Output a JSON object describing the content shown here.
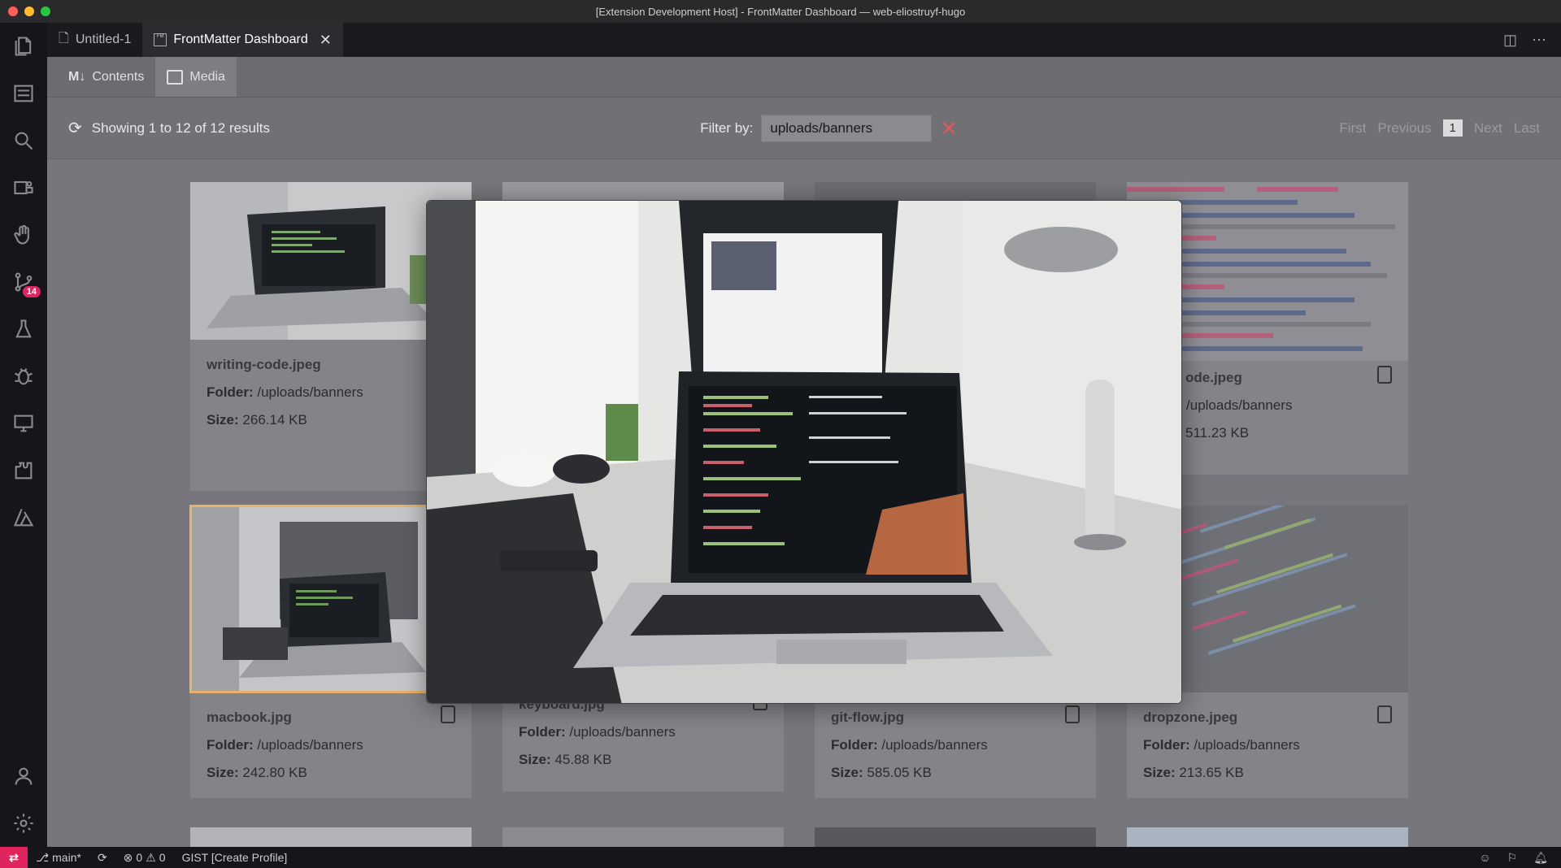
{
  "window": {
    "title": "[Extension Development Host] - FrontMatter Dashboard — web-eliostruyf-hugo"
  },
  "tabs": [
    {
      "label": "Untitled-1"
    },
    {
      "label": "FrontMatter Dashboard"
    }
  ],
  "activity": {
    "badge": "14"
  },
  "subnav": {
    "contents": "Contents",
    "media": "Media",
    "md_mark": "M↓"
  },
  "toolbar": {
    "results": "Showing 1 to 12 of 12 results",
    "filter_label": "Filter by:",
    "filter_value": "uploads/banners",
    "clear": "✕",
    "pager": {
      "first": "First",
      "previous": "Previous",
      "current": "1",
      "next": "Next",
      "last": "Last"
    }
  },
  "cards": [
    {
      "name": "writing-code.jpeg",
      "folder_label": "Folder:",
      "folder": "/uploads/banners",
      "size_label": "Size:",
      "size": "266.14 KB"
    },
    {
      "name": "ode.jpeg",
      "folder_label": "r:",
      "folder": "/uploads/banners",
      "size_label": "",
      "size": "511.23 KB"
    },
    {
      "name": "macbook.jpg",
      "folder_label": "Folder:",
      "folder": "/uploads/banners",
      "size_label": "Size:",
      "size": "242.80 KB"
    },
    {
      "name": "keyboard.jpg",
      "folder_label": "Folder:",
      "folder": "/uploads/banners",
      "size_label": "Size:",
      "size": "45.88 KB"
    },
    {
      "name": "git-flow.jpg",
      "folder_label": "Folder:",
      "folder": "/uploads/banners",
      "size_label": "Size:",
      "size": "585.05 KB"
    },
    {
      "name": "dropzone.jpeg",
      "folder_label": "Folder:",
      "folder": "/uploads/banners",
      "size_label": "Size:",
      "size": "213.65 KB"
    }
  ],
  "statusbar": {
    "branch": "main*",
    "errors": "0",
    "warnings": "0",
    "gist": "GIST [Create Profile]"
  },
  "colors": {
    "accent": "#e0245e",
    "selected_outline": "#e7b36a"
  }
}
